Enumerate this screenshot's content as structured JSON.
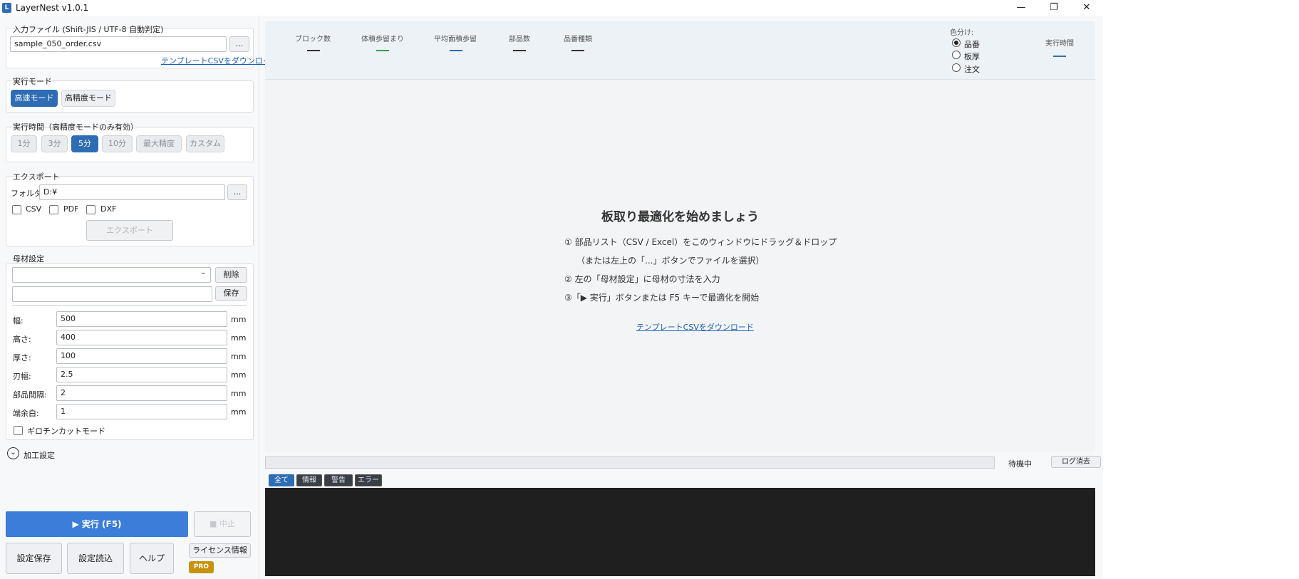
{
  "window": {
    "title": "LayerNest v1.0.1",
    "minimize": "—",
    "maximize": "❐",
    "close": "✕"
  },
  "input_file": {
    "group_label": "入力ファイル (Shift-JIS / UTF-8 自動判定)",
    "value": "sample_050_order.csv",
    "browse": "...",
    "template_link": "テンプレートCSVをダウンロード"
  },
  "exec_mode": {
    "label": "実行モード",
    "options": [
      "高速モード",
      "高精度モード"
    ],
    "selected": "高速モード"
  },
  "exec_time": {
    "label": "実行時間（高精度モードのみ有効）",
    "options": [
      "1分",
      "3分",
      "5分",
      "10分",
      "最大精度",
      "カスタム"
    ],
    "selected": "5分"
  },
  "export": {
    "label": "エクスポート",
    "folder_label": "フォルダ:",
    "folder_value": "D:¥",
    "browse": "...",
    "formats": [
      "CSV",
      "PDF",
      "DXF"
    ],
    "button": "エクスポート"
  },
  "material": {
    "label": "母材設定",
    "delete": "削除",
    "save": "保存",
    "fields": [
      {
        "label": "幅:",
        "value": "500",
        "unit": "mm"
      },
      {
        "label": "高さ:",
        "value": "400",
        "unit": "mm"
      },
      {
        "label": "厚さ:",
        "value": "100",
        "unit": "mm"
      },
      {
        "label": "刃幅:",
        "value": "2.5",
        "unit": "mm"
      },
      {
        "label": "部品間隔:",
        "value": "2",
        "unit": "mm"
      },
      {
        "label": "端余白:",
        "value": "1",
        "unit": "mm"
      }
    ],
    "guillotine": "ギロチンカットモード"
  },
  "processing": {
    "label": "加工設定"
  },
  "actions": {
    "run": "▶ 実行 (F5)",
    "stop": "■ 中止",
    "save_settings": "設定保存",
    "load_settings": "設定読込",
    "help": "ヘルプ",
    "license": "ライセンス情報",
    "badge": "PRO"
  },
  "stats": {
    "items": [
      {
        "label": "ブロック数",
        "value": "—",
        "color": "#333333"
      },
      {
        "label": "体積歩留まり",
        "value": "—",
        "color": "#2aa34a"
      },
      {
        "label": "平均面積歩留",
        "value": "—",
        "color": "#2e6db4"
      },
      {
        "label": "部品数",
        "value": "—",
        "color": "#333333"
      },
      {
        "label": "品番種類",
        "value": "—",
        "color": "#333333"
      }
    ],
    "color_by": {
      "label": "色分け:",
      "options": [
        "品番",
        "板厚",
        "注文"
      ],
      "selected": "品番"
    },
    "exec_time": {
      "label": "実行時間",
      "value": "—",
      "color": "#2e6db4"
    }
  },
  "welcome": {
    "title": "板取り最適化を始めましょう",
    "steps": [
      "① 部品リスト（CSV / Excel）をこのウィンドウにドラッグ＆ドロップ",
      "（または左上の「...」ボタンでファイルを選択）",
      "② 左の「母材設定」に母材の寸法を入力",
      "③「▶ 実行」ボタンまたは F5 キーで最適化を開始"
    ],
    "template_link": "テンプレートCSVをダウンロード"
  },
  "status": {
    "text": "待機中",
    "clear_log": "ログ消去",
    "progress": 0
  },
  "log_filters": {
    "options": [
      "全て",
      "情報",
      "警告",
      "エラー"
    ],
    "selected": "全て"
  }
}
